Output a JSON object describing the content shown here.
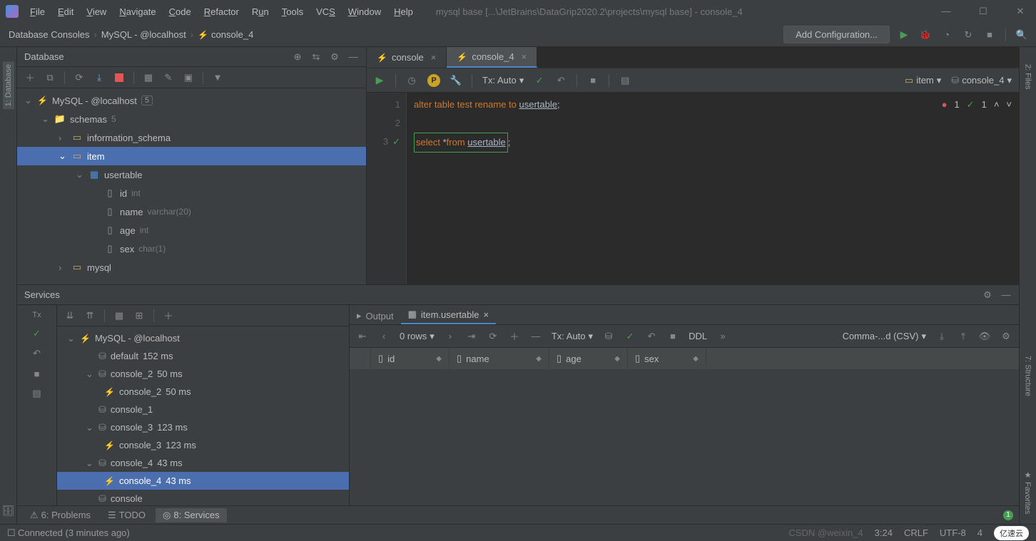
{
  "title": "mysql base [...\\JetBrains\\DataGrip2020.2\\projects\\mysql base] - console_4",
  "menubar": [
    "File",
    "Edit",
    "View",
    "Navigate",
    "Code",
    "Refactor",
    "Run",
    "Tools",
    "VCS",
    "Window",
    "Help"
  ],
  "breadcrumb": {
    "items": [
      "Database Consoles",
      "MySQL - @localhost",
      "console_4"
    ]
  },
  "config_button": "Add Configuration...",
  "left_rail": {
    "item1": "1: Database"
  },
  "right_rail": {
    "item1": "2: Files",
    "item2": "7: Structure"
  },
  "db_panel": {
    "title": "Database",
    "tree": {
      "root": "MySQL - @localhost",
      "root_badge": "5",
      "schemas": {
        "label": "schemas",
        "count": "5"
      },
      "nodes": [
        "information_schema",
        "item",
        "mysql"
      ],
      "table": "usertable",
      "cols": [
        {
          "name": "id",
          "type": "int"
        },
        {
          "name": "name",
          "type": "varchar(20)"
        },
        {
          "name": "age",
          "type": "int"
        },
        {
          "name": "sex",
          "type": "char(1)"
        }
      ]
    }
  },
  "editor": {
    "tabs": [
      {
        "label": "console"
      },
      {
        "label": "console_4"
      }
    ],
    "tx": "Tx: Auto",
    "dd_item": "item",
    "dd_console": "console_4",
    "gutter": [
      "1",
      "2",
      "3"
    ],
    "code": {
      "l1": {
        "a": "alter",
        "b": "table",
        "c": "test",
        "d": "rename",
        "e": "to",
        "f": "usertable"
      },
      "l3": {
        "a": "select",
        "b": "*",
        "c": "from",
        "d": "usertable"
      }
    },
    "status": {
      "err": "1",
      "ok": "1"
    }
  },
  "services": {
    "title": "Services",
    "tree": {
      "root": "MySQL - @localhost",
      "items": [
        {
          "label": "default",
          "time": "152 ms",
          "indent": 1
        },
        {
          "label": "console_2",
          "time": "50 ms",
          "indent": 1,
          "exp": true
        },
        {
          "label": "console_2",
          "time": "50 ms",
          "indent": 2,
          "sql": true
        },
        {
          "label": "console_1",
          "time": "",
          "indent": 1
        },
        {
          "label": "console_3",
          "time": "123 ms",
          "indent": 1,
          "exp": true
        },
        {
          "label": "console_3",
          "time": "123 ms",
          "indent": 2,
          "sql": true
        },
        {
          "label": "console_4",
          "time": "43 ms",
          "indent": 1,
          "exp": true
        },
        {
          "label": "console_4",
          "time": "43 ms",
          "indent": 2,
          "sql": true,
          "sel": true
        },
        {
          "label": "console",
          "time": "",
          "indent": 1
        }
      ]
    },
    "output": {
      "tabs": [
        "Output",
        "item.usertable"
      ],
      "rows_label": "0 rows",
      "tx": "Tx: Auto",
      "ddl": "DDL",
      "export": "Comma-...d (CSV)",
      "cols": [
        "id",
        "name",
        "age",
        "sex"
      ]
    }
  },
  "bottom_tabs": {
    "problems": "6: Problems",
    "todo": "TODO",
    "services": "8: Services"
  },
  "statusbar": {
    "left": "Connected (3 minutes ago)",
    "pos": "3:24",
    "crlf": "CRLF",
    "enc": "UTF-8",
    "spaces": "4"
  },
  "watermark": "CSDN @weixin_4",
  "logo": "亿速云"
}
